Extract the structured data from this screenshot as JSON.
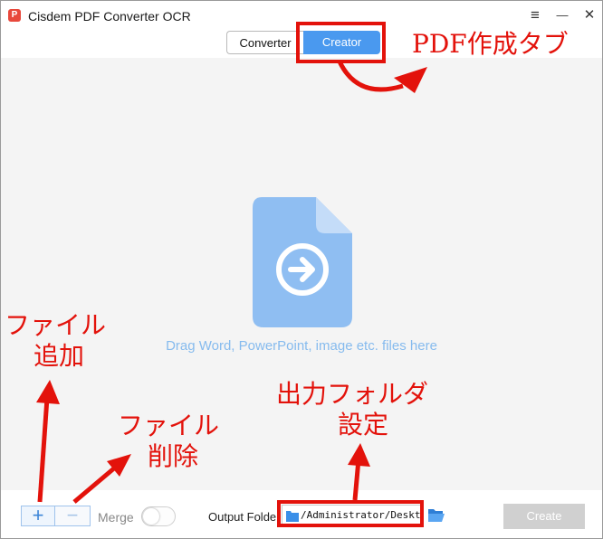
{
  "window": {
    "title": "Cisdem PDF Converter OCR",
    "logo_letter": "P",
    "menu_glyph": "≡",
    "minimize_glyph": "—",
    "close_glyph": "✕"
  },
  "tabs": [
    {
      "label": "Converter",
      "active": false
    },
    {
      "label": "Creator",
      "active": true
    }
  ],
  "dropzone": {
    "hint": "Drag Word, PowerPoint, image etc. files here",
    "icon": "file-arrow-icon"
  },
  "bottom": {
    "add_label": "+",
    "remove_label": "−",
    "merge_label": "Merge",
    "merge_on": false,
    "output_folder_label": "Output Folder",
    "output_path": "/Administrator/Desktop",
    "create_label": "Create"
  },
  "annotations": {
    "creator_tab": "PDF作成タブ",
    "add_file_line1": "ファイル",
    "add_file_line2": "追加",
    "remove_file_line1": "ファイル",
    "remove_file_line2": "削除",
    "output_line1": "出力フォルダ",
    "output_line2": "設定"
  },
  "colors": {
    "accent": "#4a99ef",
    "annotation_red": "#e3120b",
    "icon_blue": "#8fbef2",
    "hint_text": "#86bbee"
  }
}
